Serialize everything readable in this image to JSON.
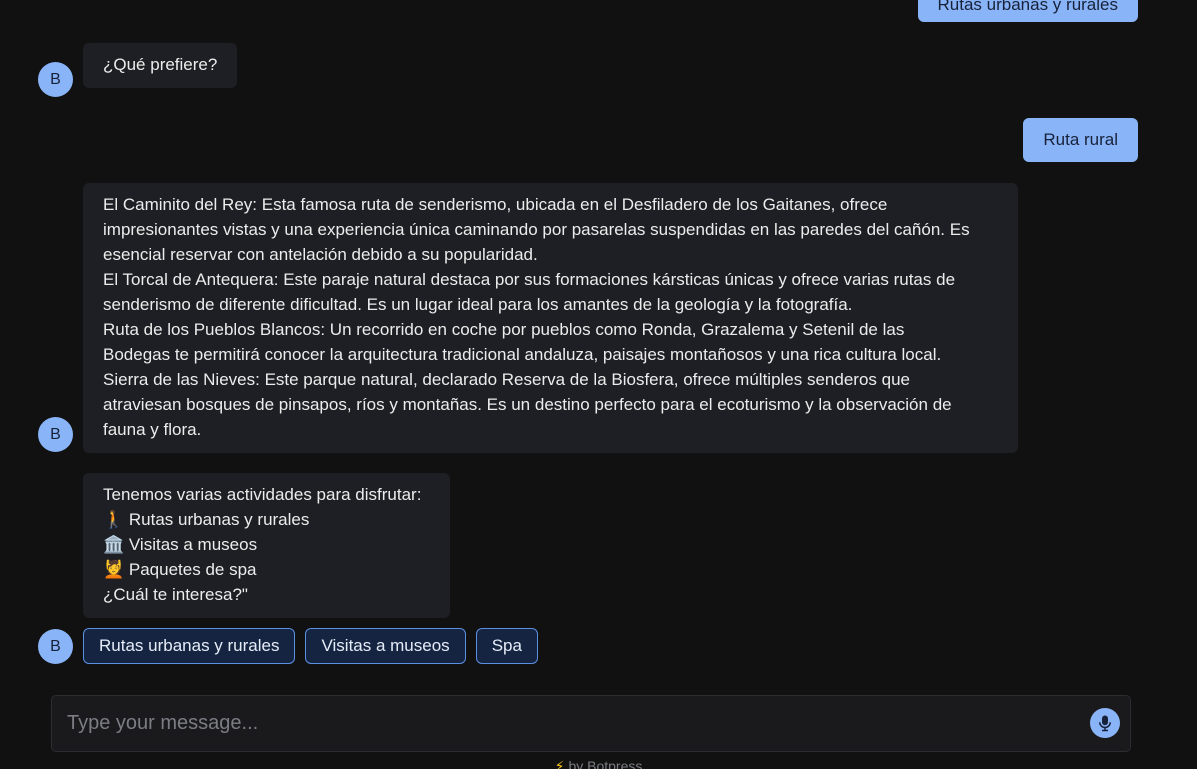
{
  "messages": {
    "user_top": "Rutas urbanas y rurales",
    "bot_question": "¿Qué prefiere?",
    "user_rural": "Ruta rural",
    "bot_routes": [
      "El Caminito del Rey: Esta famosa ruta de senderismo, ubicada en el Desfiladero de los Gaitanes, ofrece",
      "impresionantes vistas y una experiencia única caminando por pasarelas suspendidas en las paredes del cañón. Es",
      "esencial reservar con antelación debido a su popularidad.",
      "El Torcal de Antequera: Este paraje natural destaca por sus formaciones kársticas únicas y ofrece varias rutas de",
      "senderismo de diferente dificultad. Es un lugar ideal para los amantes de la geología y la fotografía.",
      "Ruta de los Pueblos Blancos: Un recorrido en coche por pueblos como Ronda, Grazalema y Setenil de las",
      "Bodegas te permitirá conocer la arquitectura tradicional andaluza, paisajes montañosos y una rica cultura local.",
      "Sierra de las Nieves: Este parque natural, declarado Reserva de la Biosfera, ofrece múltiples senderos que",
      "atraviesan bosques de pinsapos, ríos y montañas. Es un destino perfecto para el ecoturismo y la observación de",
      "fauna y flora."
    ],
    "bot_activities": [
      "Tenemos varias actividades para disfrutar:",
      "🚶 Rutas urbanas y rurales",
      "🏛️ Visitas a museos",
      "💆 Paquetes de spa",
      "¿Cuál te interesa?\""
    ]
  },
  "avatar_letter": "B",
  "quick_replies": [
    "Rutas urbanas y rurales",
    "Visitas a museos",
    "Spa"
  ],
  "composer": {
    "placeholder": "Type your message...",
    "mic_icon": "microphone-icon"
  },
  "footer": {
    "bolt": "⚡",
    "text": "by Botpress"
  },
  "colors": {
    "background": "#111112",
    "bot_bubble": "#1e1f24",
    "user_bubble": "#8ab4f8",
    "accent": "#8ab4f8",
    "quick_reply_border": "#5b8fe0"
  }
}
